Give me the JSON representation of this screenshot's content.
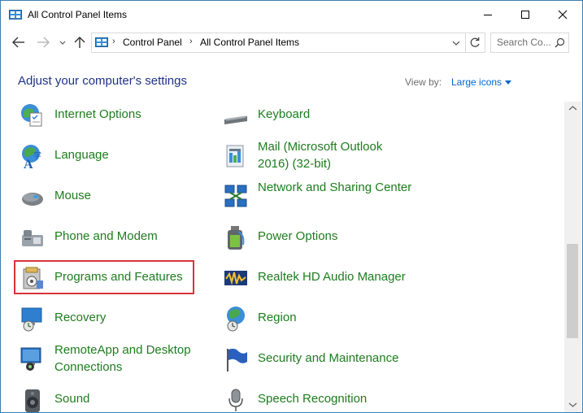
{
  "window": {
    "title": "All Control Panel Items",
    "icon": "control-panel-icon"
  },
  "navigation": {
    "breadcrumb": [
      "Control Panel",
      "All Control Panel Items"
    ],
    "search_placeholder": "Search Co..."
  },
  "header": {
    "title": "Adjust your computer's settings",
    "view_by_label": "View by:",
    "view_by_value": "Large icons"
  },
  "items": {
    "left": [
      {
        "label": "Internet Options",
        "icon": "internet-options-icon"
      },
      {
        "label": "Language",
        "icon": "language-icon"
      },
      {
        "label": "Mouse",
        "icon": "mouse-icon"
      },
      {
        "label": "Phone and Modem",
        "icon": "phone-modem-icon"
      },
      {
        "label": "Programs and Features",
        "icon": "programs-features-icon"
      },
      {
        "label": "Recovery",
        "icon": "recovery-icon"
      },
      {
        "label": "RemoteApp and Desktop Connections",
        "icon": "remoteapp-icon"
      },
      {
        "label": "Sound",
        "icon": "sound-icon"
      }
    ],
    "right": [
      {
        "label": "Keyboard",
        "icon": "keyboard-icon"
      },
      {
        "label": "Mail (Microsoft Outlook 2016) (32-bit)",
        "icon": "mail-icon"
      },
      {
        "label": "Network and Sharing Center",
        "icon": "network-icon"
      },
      {
        "label": "Power Options",
        "icon": "power-options-icon"
      },
      {
        "label": "Realtek HD Audio Manager",
        "icon": "realtek-audio-icon"
      },
      {
        "label": "Region",
        "icon": "region-icon"
      },
      {
        "label": "Security and Maintenance",
        "icon": "security-flag-icon"
      },
      {
        "label": "Speech Recognition",
        "icon": "microphone-icon"
      }
    ]
  },
  "highlighted_item": "Programs and Features",
  "colors": {
    "item_text": "#1e7c1e",
    "heading": "#1e3287",
    "link": "#0066cc",
    "highlight_border": "#d8333c",
    "window_border": "#3c7fb1"
  }
}
